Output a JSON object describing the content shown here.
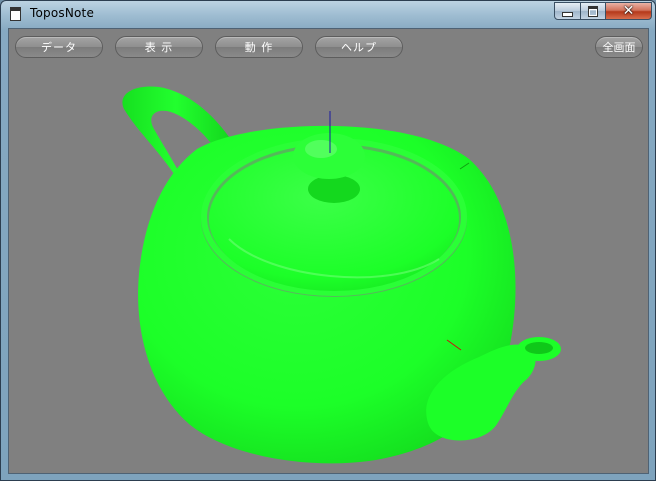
{
  "window": {
    "title": "ToposNote"
  },
  "toolbar": {
    "buttons": [
      {
        "label": "データ"
      },
      {
        "label": "表 示"
      },
      {
        "label": "動 作"
      },
      {
        "label": "ヘルプ"
      }
    ],
    "fullscreen_label": "全画面"
  },
  "scene": {
    "object": "teapot",
    "color": "#1cff28",
    "background": "#808080"
  }
}
